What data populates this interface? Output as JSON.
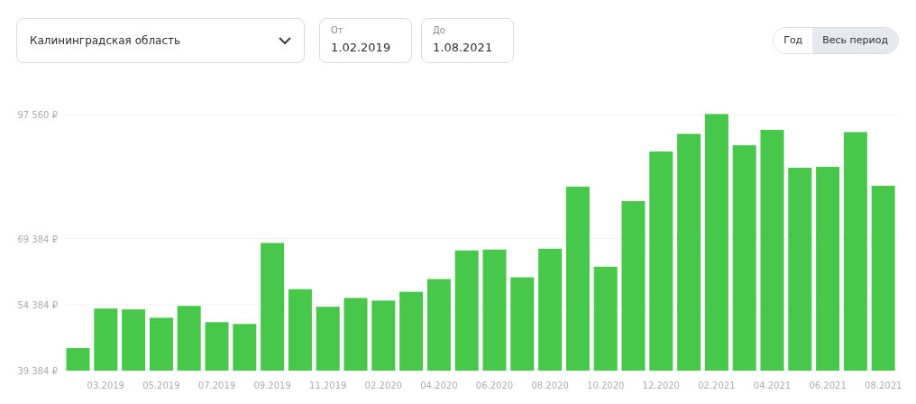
{
  "region_select": {
    "value": "Калининградская область"
  },
  "date_from": {
    "label": "От",
    "value": "1.02.2019"
  },
  "date_to": {
    "label": "До",
    "value": "1.08.2021"
  },
  "period_toggle": [
    {
      "label": "Год",
      "selected": false
    },
    {
      "label": "Весь период",
      "selected": true
    }
  ],
  "chart_data": {
    "type": "bar",
    "categories": [
      null,
      "03.2019",
      null,
      "05.2019",
      null,
      "07.2019",
      null,
      "09.2019",
      null,
      "11.2019",
      null,
      "02.2020",
      null,
      "04.2020",
      null,
      "06.2020",
      null,
      "08.2020",
      null,
      "10.2020",
      null,
      "12.2020",
      null,
      "02.2021",
      null,
      "04.2021",
      null,
      "06.2021",
      null,
      "08.2021"
    ],
    "series": [
      {
        "color": "#47c84b",
        "values": [
          44500,
          53500,
          53300,
          51400,
          54100,
          50400,
          50000,
          68400,
          57900,
          53900,
          55900,
          55300,
          57300,
          60200,
          66700,
          66900,
          60600,
          67100,
          81200,
          63000,
          77900,
          89200,
          93200,
          97700,
          90600,
          94100,
          85500,
          85700,
          93600,
          81400
        ]
      }
    ],
    "ylim": [
      39384,
      98000
    ],
    "yticks": [
      {
        "value": 39384,
        "label": "39 384 ₽"
      },
      {
        "value": 54384,
        "label": "54 384 ₽"
      },
      {
        "value": 69384,
        "label": "69 384 ₽"
      },
      {
        "value": 97560,
        "label": "97 560 ₽"
      }
    ]
  }
}
